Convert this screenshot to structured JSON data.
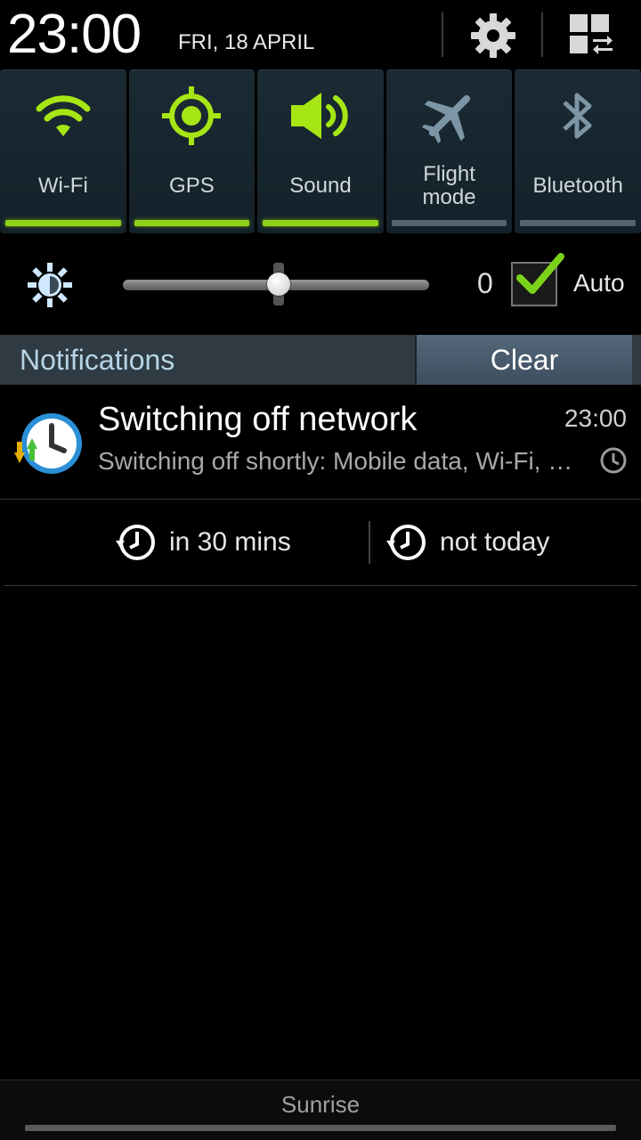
{
  "status": {
    "time": "23:00",
    "date": "FRI, 18 APRIL"
  },
  "header_icons": [
    "settings-gear-icon",
    "quick-panel-edit-icon"
  ],
  "quick_settings": [
    {
      "label": "Wi-Fi",
      "icon": "wifi-icon",
      "enabled": true
    },
    {
      "label": "GPS",
      "icon": "gps-icon",
      "enabled": true
    },
    {
      "label": "Sound",
      "icon": "speaker-icon",
      "enabled": true
    },
    {
      "label": "Flight mode",
      "icon": "airplane-icon",
      "enabled": false
    },
    {
      "label": "Bluetooth",
      "icon": "bluetooth-icon",
      "enabled": false
    }
  ],
  "brightness": {
    "level": 0.51,
    "value_label": "0",
    "auto_label": "Auto",
    "auto_checked": true
  },
  "notifications_panel": {
    "title": "Notifications",
    "clear_label": "Clear"
  },
  "notification": {
    "title": "Switching off network",
    "time": "23:00",
    "text": "Switching off shortly: Mobile data, Wi-Fi, Bluetooth",
    "actions": [
      {
        "label": "in 30 mins",
        "icon": "snooze-clock-icon"
      },
      {
        "label": "not today",
        "icon": "snooze-clock-icon"
      }
    ]
  },
  "footer": {
    "carrier": "Sunrise"
  },
  "colors": {
    "active": "#8fd11a",
    "inactive": "#56656d",
    "inactive_icon": "#7d96a6",
    "panel_bg": "#1b2a33",
    "notif_header_bg": "#2f3a43",
    "notif_header_text": "#b6d4e6"
  }
}
